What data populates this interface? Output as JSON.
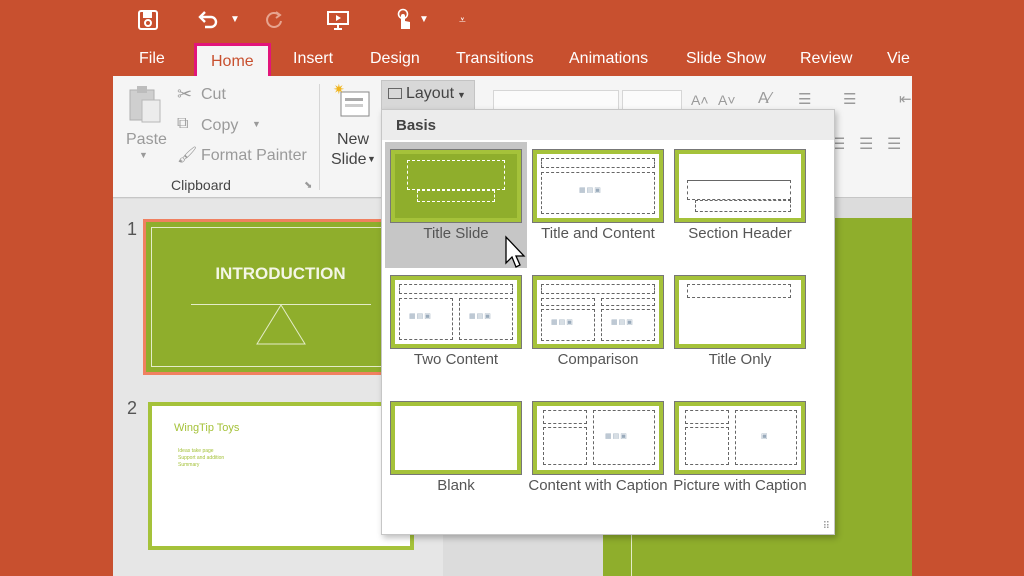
{
  "quick_access": {
    "save_icon": "save-icon",
    "undo_icon": "undo-icon",
    "redo_icon": "redo-icon",
    "present_icon": "start-from-beginning-icon",
    "touch_icon": "touch-mode-icon",
    "customize_icon": "customize-toolbar-icon"
  },
  "tabs": [
    "File",
    "Home",
    "Insert",
    "Design",
    "Transitions",
    "Animations",
    "Slide Show",
    "Review",
    "Vie"
  ],
  "active_tab": "Home",
  "ribbon": {
    "paste_label": "Paste",
    "cut_label": "Cut",
    "copy_label": "Copy",
    "format_painter_label": "Format Painter",
    "clipboard_group_label": "Clipboard",
    "new_slide_label_1": "New",
    "new_slide_label_2": "Slide",
    "layout_label": "Layout"
  },
  "gallery": {
    "header": "Basis",
    "layouts": [
      {
        "label": "Title Slide"
      },
      {
        "label": "Title and Content"
      },
      {
        "label": "Section Header"
      },
      {
        "label": "Two Content"
      },
      {
        "label": "Comparison"
      },
      {
        "label": "Title Only"
      },
      {
        "label": "Blank"
      },
      {
        "label": "Content with Caption"
      },
      {
        "label": "Picture with Caption"
      }
    ],
    "selected_index": 0
  },
  "slides": [
    {
      "number": "1",
      "title": "INTRODUCTION"
    },
    {
      "number": "2",
      "title": "WingTip Toys",
      "bullets": [
        "Ideas take page",
        "Support and addition",
        "Summary"
      ]
    }
  ],
  "colors": {
    "accent": "#c8502f",
    "theme_green": "#8fae2c",
    "highlight": "#e2157a"
  }
}
